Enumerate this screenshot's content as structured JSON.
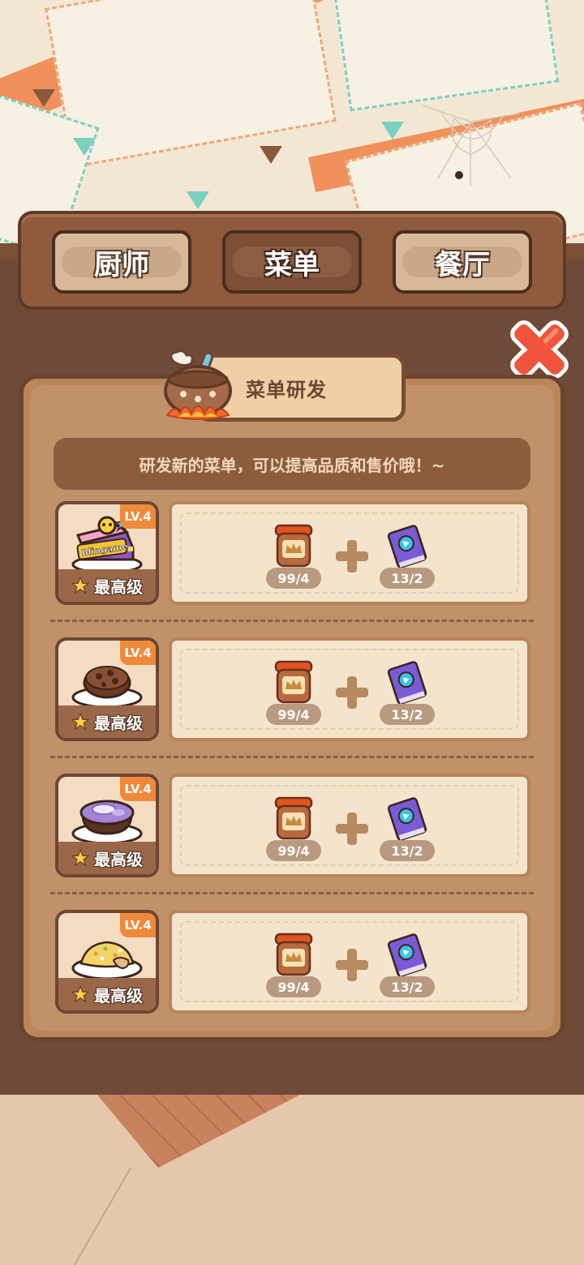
{
  "tabs": [
    {
      "label": "厨师",
      "active": false
    },
    {
      "label": "菜单",
      "active": true
    },
    {
      "label": "餐厅",
      "active": false
    }
  ],
  "panel": {
    "title": "菜单研发",
    "hint": "研发新的菜单，可以提高品质和售价哦！~"
  },
  "dishes": [
    {
      "icon": "blingame-cake-icon",
      "level": "LV.4",
      "status": "最高级",
      "ingredient_count": "99/4",
      "book_count": "13/2"
    },
    {
      "icon": "cookie-plate-icon",
      "level": "LV.4",
      "status": "最高级",
      "ingredient_count": "99/4",
      "book_count": "13/2"
    },
    {
      "icon": "purple-soup-icon",
      "level": "LV.4",
      "status": "最高级",
      "ingredient_count": "99/4",
      "book_count": "13/2"
    },
    {
      "icon": "fried-rice-icon",
      "level": "LV.4",
      "status": "最高级",
      "ingredient_count": "99/4",
      "book_count": "13/2"
    }
  ],
  "cake_text": "Blingame",
  "colors": {
    "wood_dark": "#6a4430",
    "wood_panel": "#b98559",
    "badge_orange": "#ef8a3b",
    "close_red": "#f0543a"
  }
}
